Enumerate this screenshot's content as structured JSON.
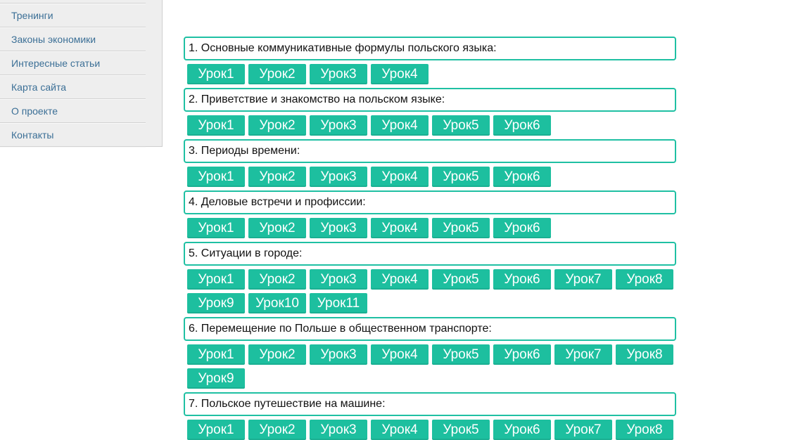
{
  "sidebar": {
    "items": [
      {
        "label": "Тренинги"
      },
      {
        "label": "Законы экономики"
      },
      {
        "label": "Интересные статьи"
      },
      {
        "label": "Карта сайта"
      },
      {
        "label": "О проекте"
      },
      {
        "label": "Контакты"
      }
    ]
  },
  "sections": [
    {
      "title": "1. Основные коммуникативные формулы польского языка:",
      "lessons": [
        "Урок1",
        "Урок2",
        "Урок3",
        "Урок4"
      ]
    },
    {
      "title": "2. Приветствие и знакомство на польском языке:",
      "lessons": [
        "Урок1",
        "Урок2",
        "Урок3",
        "Урок4",
        "Урок5",
        "Урок6"
      ]
    },
    {
      "title": "3. Периоды времени:",
      "lessons": [
        "Урок1",
        "Урок2",
        "Урок3",
        "Урок4",
        "Урок5",
        "Урок6"
      ]
    },
    {
      "title": "4. Деловые встречи и профиссии:",
      "lessons": [
        "Урок1",
        "Урок2",
        "Урок3",
        "Урок4",
        "Урок5",
        "Урок6"
      ]
    },
    {
      "title": "5. Ситуации в городе:",
      "lessons": [
        "Урок1",
        "Урок2",
        "Урок3",
        "Урок4",
        "Урок5",
        "Урок6",
        "Урок7",
        "Урок8",
        "Урок9",
        "Урок10",
        "Урок11"
      ]
    },
    {
      "title": "6. Перемещение по Польше в общественном транспорте:",
      "lessons": [
        "Урок1",
        "Урок2",
        "Урок3",
        "Урок4",
        "Урок5",
        "Урок6",
        "Урок7",
        "Урок8",
        "Урок9"
      ]
    },
    {
      "title": "7. Польское путешествие на машине:",
      "lessons": [
        "Урок1",
        "Урок2",
        "Урок3",
        "Урок4",
        "Урок5",
        "Урок6",
        "Урок7",
        "Урок8"
      ]
    }
  ],
  "colors": {
    "accent": "#1dbf9f",
    "border": "#1fc0a3",
    "link": "#3b6f96"
  }
}
